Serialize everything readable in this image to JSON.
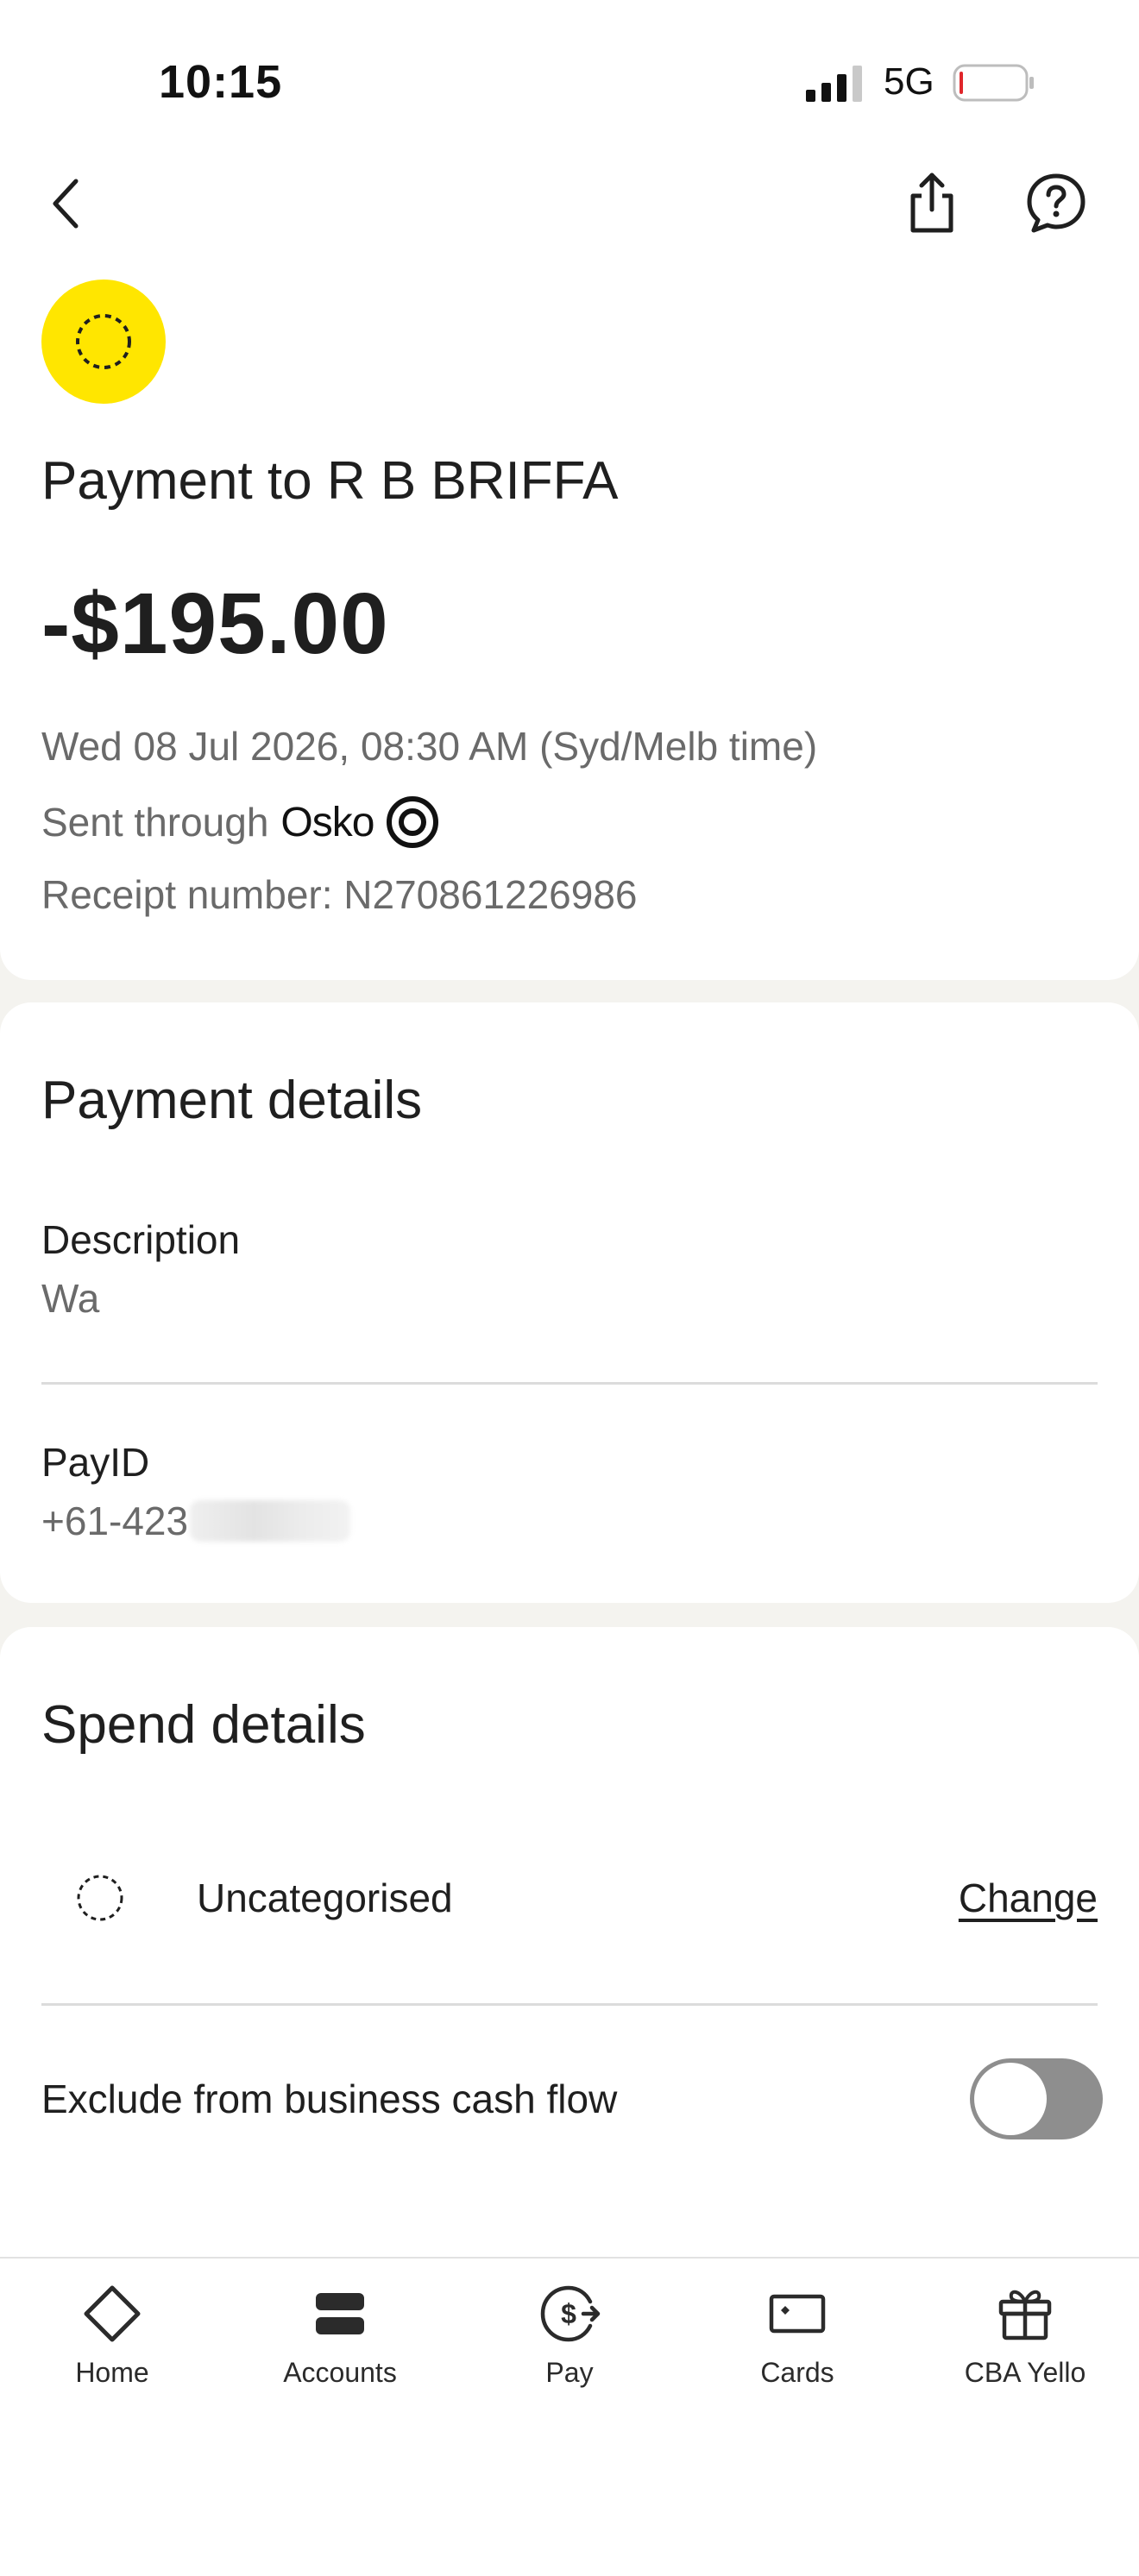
{
  "status_bar": {
    "time": "10:15",
    "network": "5G"
  },
  "header": {
    "back_icon": "chevron-left-icon",
    "share_icon": "share-icon",
    "help_icon": "help-bubble-icon"
  },
  "summary": {
    "title": "Payment to R B BRIFFA",
    "amount": "-$195.00",
    "datetime": "Wed 08 Jul 2026, 08:30 AM (Syd/Melb time)",
    "sent_prefix": "Sent through",
    "sent_brand": "Osko",
    "receipt": "Receipt number: N270861226986",
    "avatar_color": "#ffe600"
  },
  "payment_details": {
    "heading": "Payment details",
    "description_label": "Description",
    "description_value": "Wa",
    "payid_label": "PayID",
    "payid_value": "+61-423"
  },
  "spend_details": {
    "heading": "Spend details",
    "category": "Uncategorised",
    "change_label": "Change",
    "exclude_label": "Exclude from business cash flow",
    "exclude_enabled": false
  },
  "tab_bar": {
    "tabs": [
      {
        "label": "Home",
        "icon": "diamond-home-icon"
      },
      {
        "label": "Accounts",
        "icon": "accounts-icon"
      },
      {
        "label": "Pay",
        "icon": "pay-icon"
      },
      {
        "label": "Cards",
        "icon": "card-icon"
      },
      {
        "label": "CBA Yello",
        "icon": "gift-icon"
      }
    ]
  }
}
